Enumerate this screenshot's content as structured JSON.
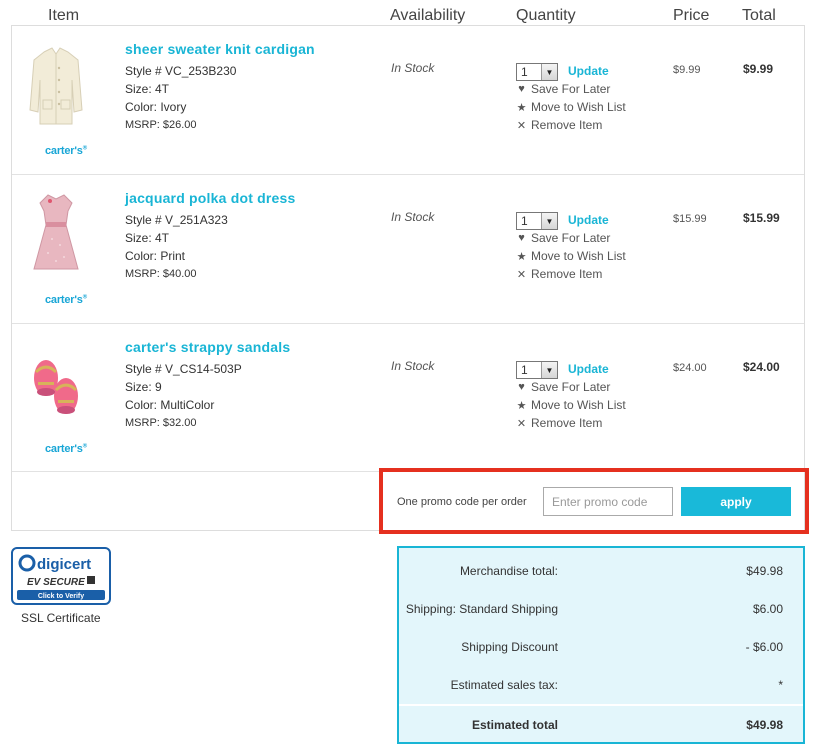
{
  "columns": {
    "item": "Item",
    "availability": "Availability",
    "quantity": "Quantity",
    "price": "Price",
    "total": "Total"
  },
  "brand": {
    "name": "carter's",
    "mark": "®",
    "color": "#19a6d6"
  },
  "actions": {
    "update": "Update",
    "save_later": "Save For Later",
    "wish_list": "Move to Wish List",
    "remove": "Remove Item"
  },
  "items": [
    {
      "name": "sheer sweater knit cardigan",
      "style": "Style # VC_253B230",
      "size": "Size: 4T",
      "color": "Color: Ivory",
      "msrp": "MSRP: $26.00",
      "availability": "In Stock",
      "quantity": "1",
      "price": "$9.99",
      "total": "$9.99",
      "image": "cardigan-image"
    },
    {
      "name": "jacquard polka dot dress",
      "style": "Style # V_251A323",
      "size": "Size: 4T",
      "color": "Color: Print",
      "msrp": "MSRP: $40.00",
      "availability": "In Stock",
      "quantity": "1",
      "price": "$15.99",
      "total": "$15.99",
      "image": "dress-image"
    },
    {
      "name": "carter's strappy sandals",
      "style": "Style # V_CS14-503P",
      "size": "Size: 9",
      "color": "Color: MultiColor",
      "msrp": "MSRP: $32.00",
      "availability": "In Stock",
      "quantity": "1",
      "price": "$24.00",
      "total": "$24.00",
      "image": "sandals-image"
    }
  ],
  "promo": {
    "label": "One promo code per order",
    "placeholder": "Enter promo code",
    "apply": "apply",
    "highlight_color": "#e5301f"
  },
  "ssl": {
    "brand": "digicert",
    "ev": "EV SECURE",
    "verify": "Click to Verify",
    "label": "SSL Certificate"
  },
  "summary": {
    "merch_label": "Merchandise total:",
    "merch_value": "$49.98",
    "ship_label": "Shipping: Standard Shipping",
    "ship_value": "$6.00",
    "disc_label": "Shipping Discount",
    "disc_value": "- $6.00",
    "tax_label": "Estimated sales tax:",
    "tax_value": "*",
    "total_label": "Estimated total",
    "total_value": "$49.98"
  },
  "colors": {
    "accent": "#19b5d5",
    "summary_bg": "#e3f6fb"
  }
}
